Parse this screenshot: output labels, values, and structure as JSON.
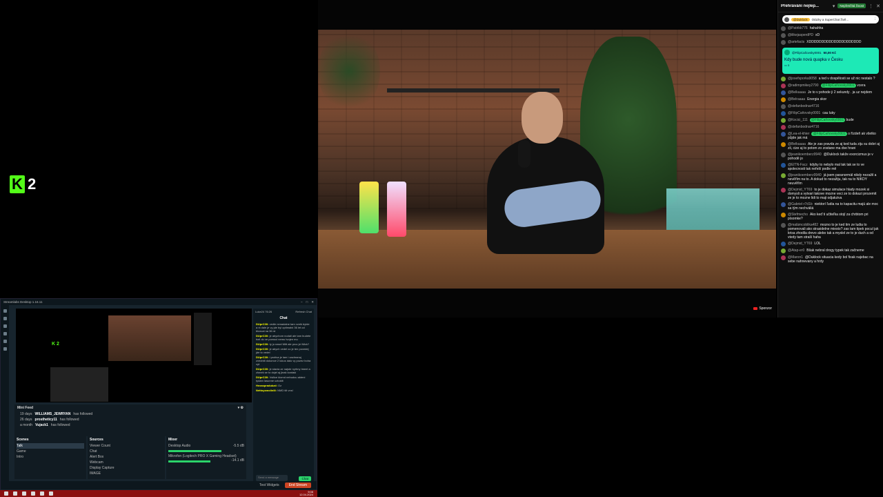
{
  "brand": {
    "glyph": "K",
    "number": "2",
    "accent": "#53fc18"
  },
  "video": {
    "badge": "Sponzor"
  },
  "chat": {
    "header_title": "Přehrávání nejlep...",
    "header_pill": "Nepřetržitá živost",
    "pinned_tag": "@Duklock",
    "pinned_text": "Otázky a SuperChat živě...",
    "messages_top": [
      {
        "user": "@Patrikk776",
        "text": "hahahha"
      },
      {
        "user": "@ilikejasperdPD",
        "text": "xD"
      },
      {
        "user": "@artefacts",
        "text": "XDDDDDDDDDDDDDDDDDDDDD"
      }
    ],
    "superchat": {
      "user": "@FilipCaňovsky0001",
      "amount": "50,00 Kč",
      "text": "Kdy bude nová quapka v Česku",
      "count": "3"
    },
    "messages": [
      {
        "user": "@josefsporka9058",
        "text": "a ted v dospělosti se už nic nestalo ?"
      },
      {
        "user": "@radimpmikey2790",
        "chip": "@FilipCaňovsky0001",
        "text": "vcera"
      },
      {
        "user": "@Belkaaaa",
        "text": "Je to v pohode ji 2 sekundy . ja uz nejdem"
      },
      {
        "user": "@Belraaaa",
        "text": "Energia skor"
      },
      {
        "user": "@stefanbodnar4716",
        "text": ""
      },
      {
        "user": "@FilipCaňovsky0001",
        "text": "cau luky"
      },
      {
        "user": "@Kocici_111",
        "chip": "@FilipCaňovsky0001",
        "text": "bude"
      },
      {
        "user": "@stefanbodnar4716",
        "text": ""
      },
      {
        "user": "@Lea-el-khier",
        "chip": "@FilipCaňovsky0001",
        "text": "o řízdeň ak všetko půjde jak má"
      },
      {
        "user": "@Belkaaaa",
        "text": "Ale je zas pravda ze aj ked tuda ziju su dobri aj zli, cize aj to potom zo zostane ma dve hrani"
      },
      {
        "user": "@jeanikoemberz9940",
        "text": "@Duklock takže exorcizmus je v pohodě jo"
      },
      {
        "user": "@ElTN-Facz",
        "text": "kdyby to nebylo mal tak tak se to ve spolecnosti tak neřeší podle mě"
      },
      {
        "user": "@jeanikoemberz9940",
        "text": "já jsem paranormál nikdy nezažil a nevěřím na to. A dokud to nezažiju, tak na to NIKDY neuvěřím"
      },
      {
        "user": "@Dejmid_YT69",
        "text": "to je dokaz simulace hlady mozek si domysli a vytvari takove mozne veci ze to dokazi prozemit ze je to mozne lidi to maji odjakziva"
      },
      {
        "user": "@Gabriel-r7d1b",
        "text": "niektorí ľudia na to kapacitu majú ale moc sa tým nechváliá"
      },
      {
        "user": "@Stefmecho",
        "text": "Ako keď ti učiteľka stojí za chrbtom pri písomke?"
      },
      {
        "user": "@malámcoblika482",
        "text": "mozno to je ked tim ze ludia to pomenovali ako strasidelne miesto? zas tam tipek pocul jak krisa zhodila drevo alebo tak a myslel ze to je duch a od vtedy tam straší haha"
      },
      {
        "user": "@Dejmid_YT69",
        "text": "LOL"
      },
      {
        "user": "@Atap-er0",
        "text": "Bšak nebral drogy typek tak začneme"
      },
      {
        "user": "@Maron1",
        "text": "@Duklock situacia kedy bol fixak najebac na sebe nahnevany a hrdy"
      }
    ]
  },
  "streamlabs": {
    "title": "Streamlabs Desktop 1.16.11",
    "minifeed_title": "Mini Feed",
    "feed": [
      {
        "time": "19 days",
        "user": "WILLIAMS_JEWRYAN",
        "action": "has followed"
      },
      {
        "time": "26 days",
        "user": "prostheticy11",
        "action": "has followed"
      },
      {
        "time": "a month",
        "user": "Vujack1",
        "action": "has followed"
      }
    ],
    "scenes_title": "Scenes",
    "scenes": [
      "Talk",
      "Game",
      "Intro"
    ],
    "sources_title": "Sources",
    "sources": [
      "Viewer Count",
      "Chat",
      "Alert Box",
      "Webcam",
      "Display Capture",
      "IMAGE"
    ],
    "mixer_title": "Mixer",
    "mixer": [
      {
        "name": "Desktop Audio",
        "db": "-5.5 dB"
      },
      {
        "name": "Mikrofon (Logitech PRO X Gaming Headset)",
        "db": "-14.1 dB"
      }
    ],
    "chat_title": "Chat",
    "chat_user": "Luke24 76:26",
    "chat_refresh": "Refresh Chat",
    "chat_lines": [
      {
        "user": "DUprC30:",
        "text": "vedle nenadalne tam vznik bylde a ni dale je vy jde byl optimalni 36 let od bloxcal na 36 rd"
      },
      {
        "user": "DUprC30:",
        "text": "je abychom nodali ale tam budete tvel do ve pomoci nemu tvojen mu"
      },
      {
        "user": "DUprC30:",
        "text": "ty jo nasel Mitt ale proc jel Mick?"
      },
      {
        "user": "DUprC30:",
        "text": "je abych vedel co je ten povedej jde to vedel"
      },
      {
        "user": "DUprC30:",
        "text": "i protiva je lam i zachranuj zvedniti dokonce 2 lukus dalo vy pozez boha vyt"
      },
      {
        "user": "DUprC30:",
        "text": "je stavia ze najste nyrhny tmeel a zlonek se to dojel aj jinak kontaki"
      },
      {
        "user": "DUprC30:",
        "text": "Vsilice klomd nebudou akteni tydam lasunne uztoklit"
      },
      {
        "user": "Hexaspradukzd:",
        "text": "Oz"
      },
      {
        "user": "Nettoysmolinlli:",
        "text": "NMD tilt vns!"
      }
    ],
    "chat_placeholder": "Send a message",
    "chat_button": "Chat",
    "test_widgets": "Test Widgets",
    "end_stream": "End Stream"
  },
  "taskbar": {
    "time": "9:08",
    "date": "12.04.2024"
  }
}
